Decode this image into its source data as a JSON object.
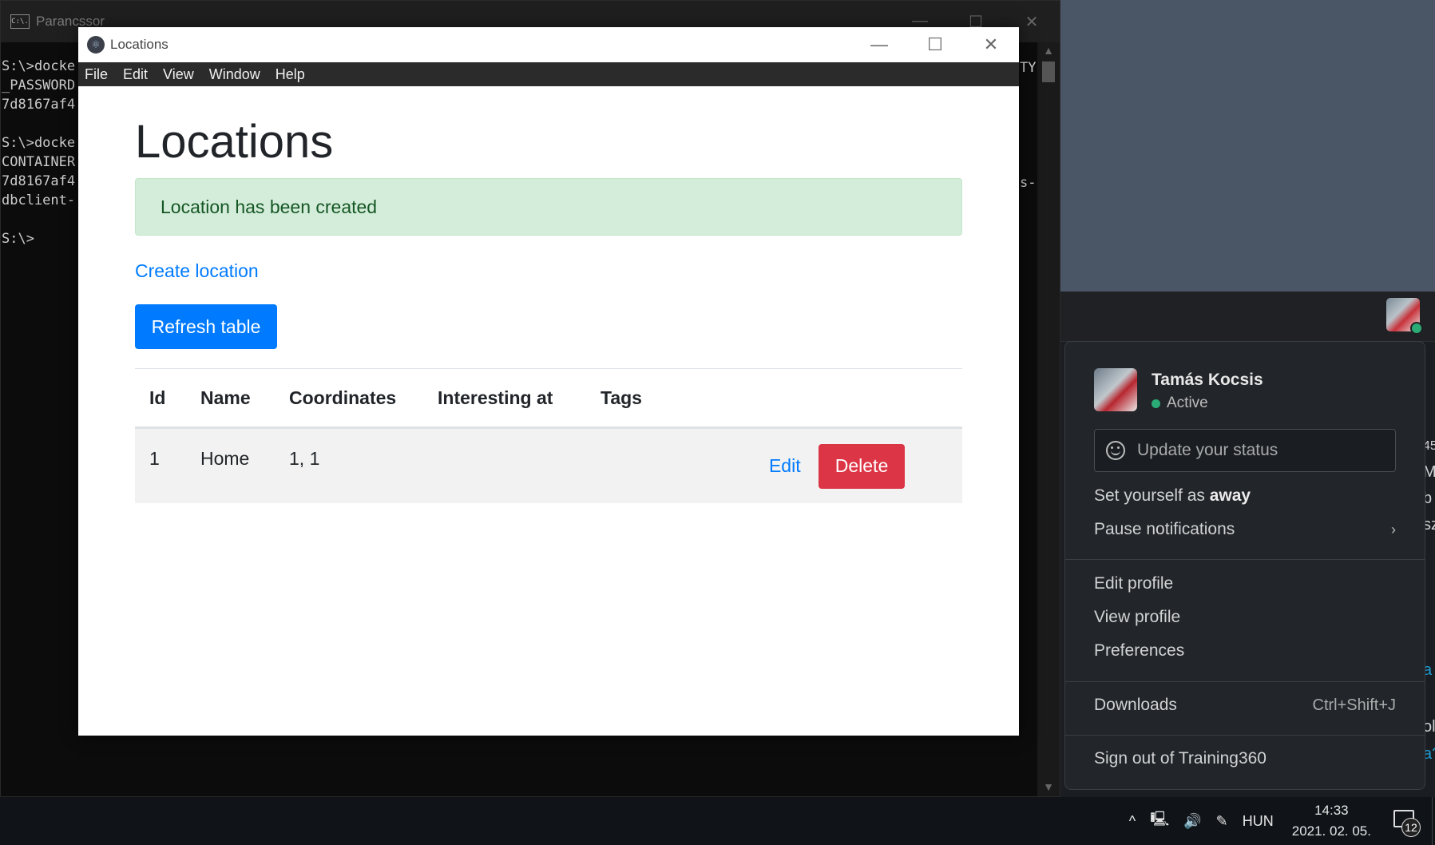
{
  "console": {
    "title": "Parancssor",
    "lines": [
      "S:\\>docke",
      "_PASSWORD",
      "7d8167af4",
      "",
      "S:\\>docke",
      "CONTAINER",
      "7d8167af4",
      "dbclient-",
      "",
      "S:\\>"
    ],
    "right_fragment_1": "TY",
    "right_fragment_2": "s-",
    "icon_label": "C:\\."
  },
  "window": {
    "title": "Locations",
    "menu": [
      "File",
      "Edit",
      "View",
      "Window",
      "Help"
    ]
  },
  "page": {
    "heading": "Locations",
    "alert": "Location has been created",
    "create_link": "Create location",
    "refresh_button": "Refresh table",
    "table": {
      "headers": [
        "Id",
        "Name",
        "Coordinates",
        "Interesting at",
        "Tags"
      ],
      "rows": [
        {
          "id": "1",
          "name": "Home",
          "coordinates": "1, 1",
          "interesting_at": "",
          "tags": "",
          "edit": "Edit",
          "delete": "Delete"
        }
      ]
    }
  },
  "slack": {
    "user_name": "Tamás Kocsis",
    "presence": "Active",
    "status_placeholder": "Update your status",
    "set_away_prefix": "Set yourself as ",
    "set_away_bold": "away",
    "pause_notifications": "Pause notifications",
    "edit_profile": "Edit profile",
    "view_profile": "View profile",
    "preferences": "Preferences",
    "downloads": "Downloads",
    "downloads_shortcut": "Ctrl+Shift+J",
    "sign_out": "Sign out of Training360",
    "edge_text": [
      "45",
      "M",
      "b",
      "sz",
      "a",
      "ol",
      "a?"
    ],
    "presence_color": "#2bac76"
  },
  "taskbar": {
    "language": "HUN",
    "time": "14:33",
    "date": "2021. 02. 05.",
    "notification_count": "12"
  },
  "colors": {
    "primary": "#007bff",
    "danger": "#dc3545",
    "success_bg": "#d4edda",
    "success_text": "#155724"
  }
}
